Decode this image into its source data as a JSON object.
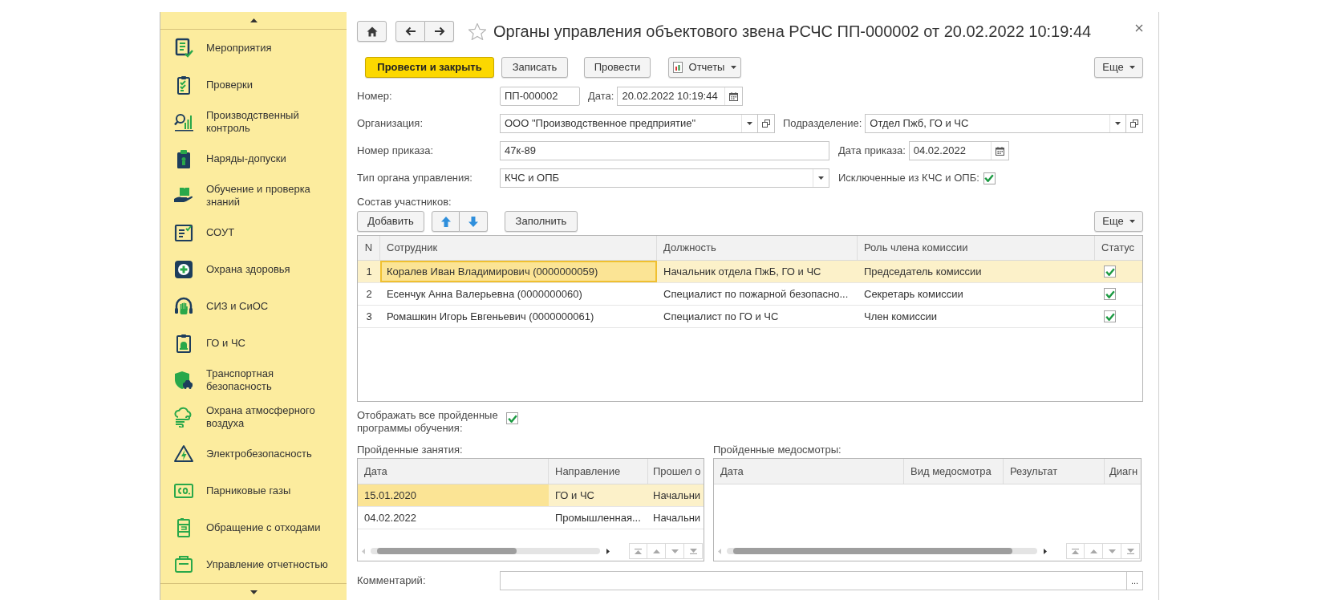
{
  "sidebar": {
    "items": [
      {
        "label": "Мероприятия"
      },
      {
        "label": "Проверки"
      },
      {
        "label": "Производственный контроль"
      },
      {
        "label": "Наряды-допуски"
      },
      {
        "label": "Обучение и проверка знаний"
      },
      {
        "label": "СОУТ"
      },
      {
        "label": "Охрана здоровья"
      },
      {
        "label": "СИЗ и СиОС"
      },
      {
        "label": "ГО и ЧС"
      },
      {
        "label": "Транспортная безопасность"
      },
      {
        "label": "Охрана атмосферного воздуха"
      },
      {
        "label": "Электробезопасность"
      },
      {
        "label": "Парниковые газы"
      },
      {
        "label": "Обращение с отходами"
      },
      {
        "label": "Управление отчетностью"
      }
    ]
  },
  "window": {
    "title": "Органы управления объектового звена РСЧС ПП-000002 от 20.02.2022 10:19:44"
  },
  "toolbar": {
    "buttons": [
      {
        "label": "Провести и закрыть",
        "kind": "primary"
      },
      {
        "label": "Записать",
        "kind": "plain"
      },
      {
        "label": "Провести",
        "kind": "plain"
      },
      {
        "label": "Отчеты",
        "kind": "menu"
      }
    ],
    "more_button": "Еще"
  },
  "form": {
    "number": {
      "label": "Номер:",
      "value": "ПП-000002"
    },
    "date": {
      "label": "Дата:",
      "value": "20.02.2022 10:19:44"
    },
    "organization": {
      "label": "Организация:",
      "value": "ООО \"Производственное предприятие\""
    },
    "department": {
      "label": "Подразделение:",
      "value": "Отдел Пжб, ГО и ЧС"
    },
    "order_number": {
      "label": "Номер приказа:",
      "value": "47к-89"
    },
    "order_date": {
      "label": "Дата приказа:",
      "value": "04.02.2022"
    },
    "body_type": {
      "label": "Тип органа управления:",
      "value": "КЧС и ОПБ"
    },
    "excluded": {
      "label": "Исключенные из КЧС и ОПБ:",
      "checked": true
    }
  },
  "participants": {
    "label": "Состав участников:",
    "add_button": "Добавить",
    "fill_button": "Заполнить",
    "more_button": "Еще",
    "table": {
      "columns": [
        "N",
        "Сотрудник",
        "Должность",
        "Роль члена комиссии",
        "Статус"
      ],
      "rows": [
        {
          "n": "1",
          "employee": "Коралев Иван Владимирович (0000000059)",
          "position": "Начальник отдела ПжБ, ГО и ЧС",
          "role": "Председатель комиссии",
          "checked": true,
          "selected": true
        },
        {
          "n": "2",
          "employee": "Есенчук Анна Валерьевна (0000000060)",
          "position": "Специалист по пожарной безопасно...",
          "role": "Секретарь комиссии",
          "checked": true,
          "selected": false
        },
        {
          "n": "3",
          "employee": "Ромашкин Игорь Евгеньевич (0000000061)",
          "position": "Специалист по ГО и ЧС",
          "role": "Член комиссии",
          "checked": true,
          "selected": false
        }
      ]
    }
  },
  "show_all_programs": {
    "label": "Отображать все пройденные программы обучения:",
    "checked": true
  },
  "lessons": {
    "label": "Пройденные занятия:",
    "table": {
      "columns": [
        "Дата",
        "Направление",
        "Прошел о"
      ],
      "rows": [
        {
          "cells": [
            "15.01.2020",
            "ГО и ЧС",
            "Начальни"
          ],
          "selected": true
        },
        {
          "cells": [
            "04.02.2022",
            "Промышленная...",
            "Начальни"
          ],
          "selected": false
        }
      ]
    }
  },
  "medical_exams": {
    "label": "Пройденные медосмотры:",
    "table": {
      "columns": [
        "Дата",
        "Вид медосмотра",
        "Результат",
        "Диагн"
      ]
    }
  },
  "comment": {
    "label": "Комментарий:",
    "select_button": "..."
  }
}
